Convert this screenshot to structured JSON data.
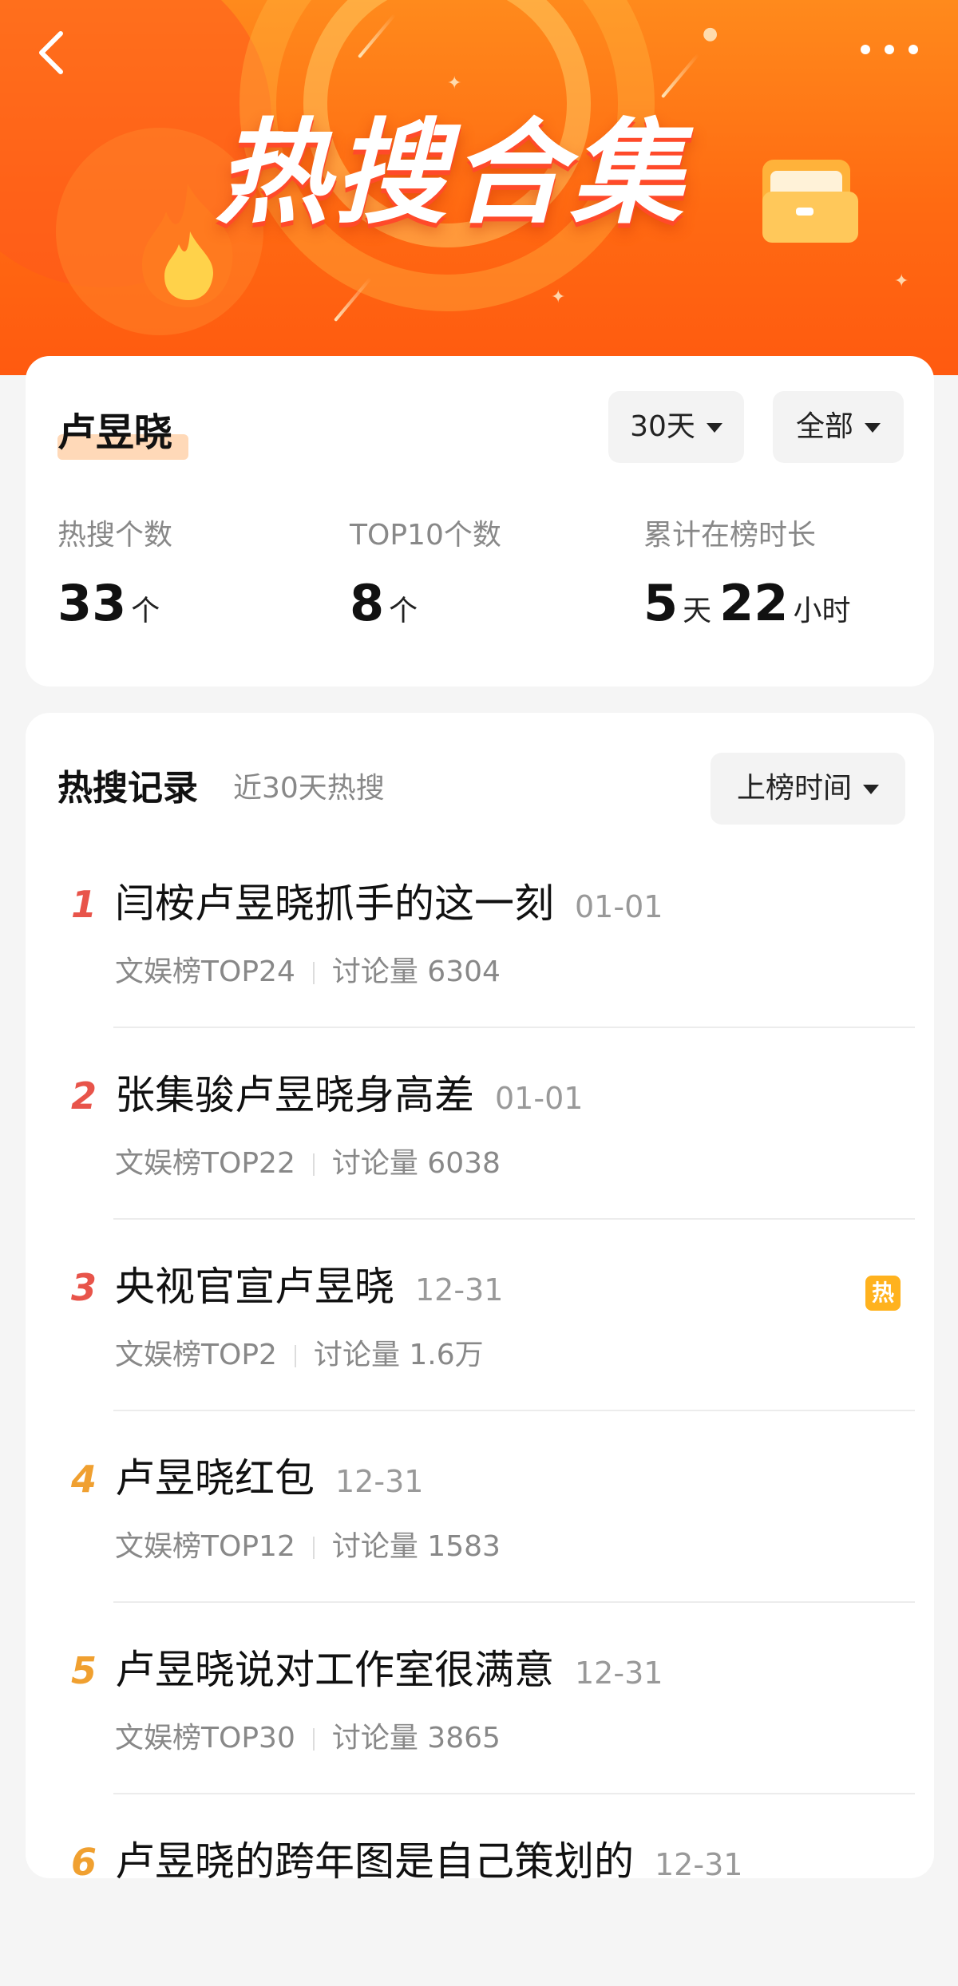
{
  "banner": {
    "title": "热搜合集",
    "colors": {
      "bg_top": "#ff8a1c",
      "bg_bottom": "#ff5a10"
    }
  },
  "summary": {
    "name": "卢昱晓",
    "filter_days": "30天",
    "filter_type": "全部",
    "stats": [
      {
        "label": "热搜个数",
        "value": "33",
        "unit": "个"
      },
      {
        "label": "TOP10个数",
        "value": "8",
        "unit": "个"
      },
      {
        "label": "累计在榜时长",
        "days": "5",
        "days_unit": "天",
        "hours": "22",
        "hours_unit": "小时"
      }
    ]
  },
  "records": {
    "title": "热搜记录",
    "subtitle": "近30天热搜",
    "sort_label": "上榜时间",
    "hot_badge": "热",
    "items": [
      {
        "rank": "1",
        "title": "闫桉卢昱晓抓手的这一刻",
        "date": "01-01",
        "board": "文娱榜TOP24",
        "discussion": "讨论量 6304",
        "rank_color": "#e8544a"
      },
      {
        "rank": "2",
        "title": "张集骏卢昱晓身高差",
        "date": "01-01",
        "board": "文娱榜TOP22",
        "discussion": "讨论量 6038",
        "rank_color": "#e8544a"
      },
      {
        "rank": "3",
        "title": "央视官宣卢昱晓",
        "date": "12-31",
        "board": "文娱榜TOP2",
        "discussion": "讨论量 1.6万",
        "rank_color": "#e8544a",
        "hot": true
      },
      {
        "rank": "4",
        "title": "卢昱晓红包",
        "date": "12-31",
        "board": "文娱榜TOP12",
        "discussion": "讨论量 1583",
        "rank_color": "#f0a030"
      },
      {
        "rank": "5",
        "title": "卢昱晓说对工作室很满意",
        "date": "12-31",
        "board": "文娱榜TOP30",
        "discussion": "讨论量 3865",
        "rank_color": "#f0a030"
      },
      {
        "rank": "6",
        "title": "卢昱晓的跨年图是自己策划的",
        "date": "12-31",
        "board": "",
        "discussion": "",
        "rank_color": "#f0a030"
      }
    ]
  }
}
